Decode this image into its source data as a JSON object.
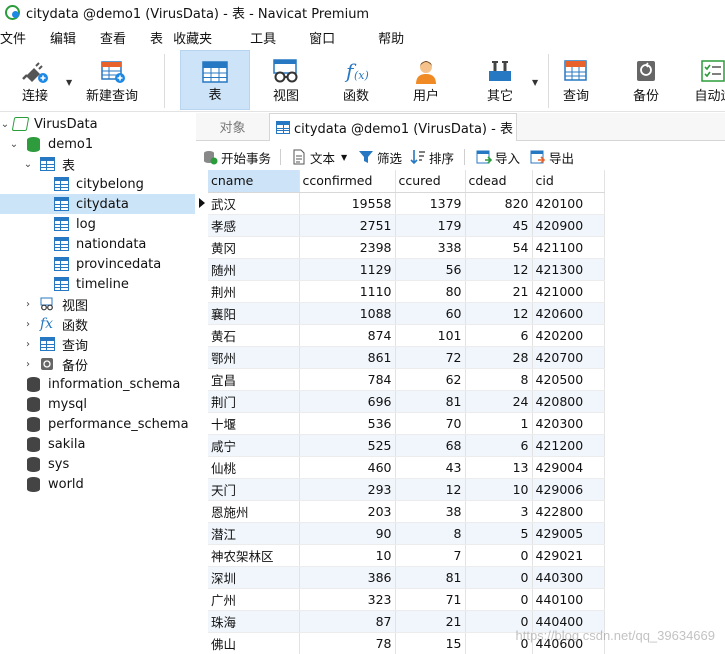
{
  "window": {
    "title": "citydata @demo1 (VirusData) - 表 - Navicat Premium"
  },
  "menu": [
    "文件",
    "编辑",
    "查看",
    "表",
    "收藏夹",
    "工具",
    "窗口",
    "帮助"
  ],
  "toolbar": {
    "connect": "连接",
    "new_query": "新建查询",
    "table": "表",
    "view": "视图",
    "function": "函数",
    "user": "用户",
    "other": "其它",
    "query": "查询",
    "backup": "备份",
    "automation": "自动运"
  },
  "navigator": {
    "connection": "VirusData",
    "database": "demo1",
    "tables_group": "表",
    "tables": [
      "citybelong",
      "citydata",
      "log",
      "nationdata",
      "provincedata",
      "timeline"
    ],
    "selected_table": "citydata",
    "views_group": "视图",
    "functions_group": "函数",
    "queries_group": "查询",
    "backups_group": "备份",
    "other_databases": [
      "information_schema",
      "mysql",
      "performance_schema",
      "sakila",
      "sys",
      "world"
    ]
  },
  "tabs": {
    "objects": "对象",
    "active": "citydata @demo1 (VirusData) - 表"
  },
  "data_toolbar": {
    "begin_transaction": "开始事务",
    "text": "文本",
    "filter": "筛选",
    "sort": "排序",
    "import": "导入",
    "export": "导出"
  },
  "grid": {
    "columns": [
      "cname",
      "cconfirmed",
      "ccured",
      "cdead",
      "cid"
    ],
    "rows": [
      [
        "武汉",
        "19558",
        "1379",
        "820",
        "420100"
      ],
      [
        "孝感",
        "2751",
        "179",
        "45",
        "420900"
      ],
      [
        "黄冈",
        "2398",
        "338",
        "54",
        "421100"
      ],
      [
        "随州",
        "1129",
        "56",
        "12",
        "421300"
      ],
      [
        "荆州",
        "1110",
        "80",
        "21",
        "421000"
      ],
      [
        "襄阳",
        "1088",
        "60",
        "12",
        "420600"
      ],
      [
        "黄石",
        "874",
        "101",
        "6",
        "420200"
      ],
      [
        "鄂州",
        "861",
        "72",
        "28",
        "420700"
      ],
      [
        "宜昌",
        "784",
        "62",
        "8",
        "420500"
      ],
      [
        "荆门",
        "696",
        "81",
        "24",
        "420800"
      ],
      [
        "十堰",
        "536",
        "70",
        "1",
        "420300"
      ],
      [
        "咸宁",
        "525",
        "68",
        "6",
        "421200"
      ],
      [
        "仙桃",
        "460",
        "43",
        "13",
        "429004"
      ],
      [
        "天门",
        "293",
        "12",
        "10",
        "429006"
      ],
      [
        "恩施州",
        "203",
        "38",
        "3",
        "422800"
      ],
      [
        "潜江",
        "90",
        "8",
        "5",
        "429005"
      ],
      [
        "神农架林区",
        "10",
        "7",
        "0",
        "429021"
      ],
      [
        "深圳",
        "386",
        "81",
        "0",
        "440300"
      ],
      [
        "广州",
        "323",
        "71",
        "0",
        "440100"
      ],
      [
        "珠海",
        "87",
        "21",
        "0",
        "440400"
      ],
      [
        "佛山",
        "78",
        "15",
        "0",
        "440600"
      ]
    ]
  },
  "watermark": "https://blog.csdn.net/qq_39634669"
}
